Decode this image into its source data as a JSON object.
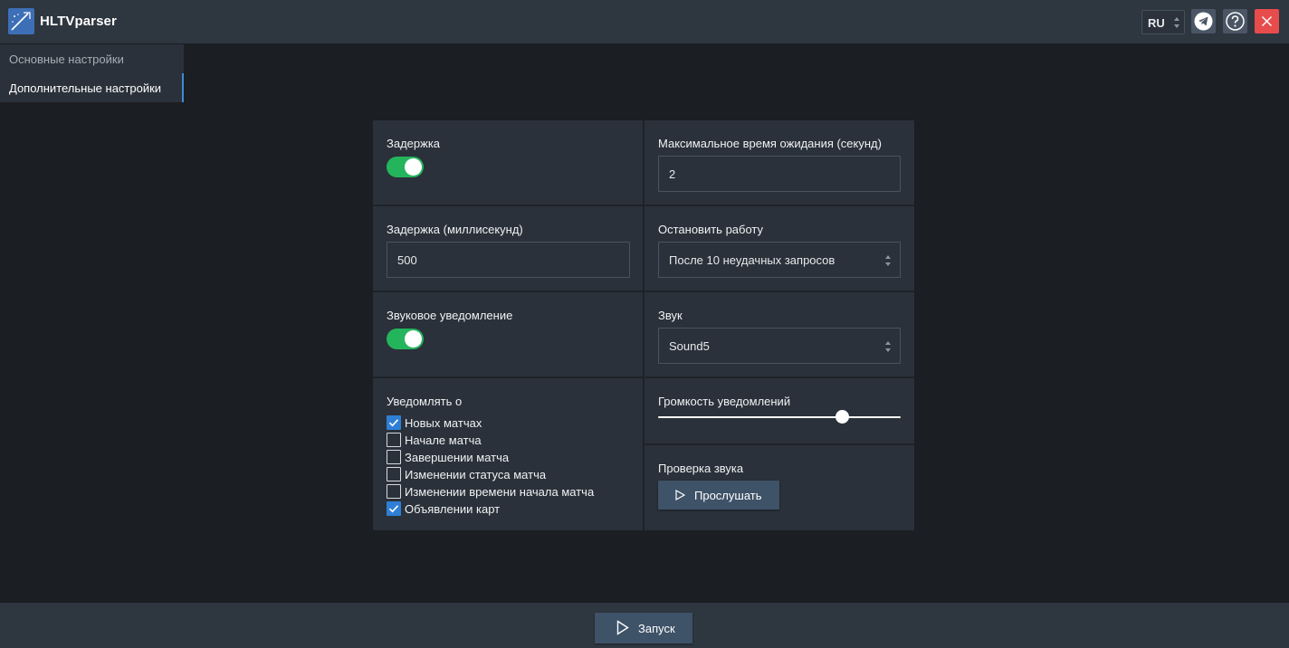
{
  "app": {
    "title": "HLTVparser",
    "language": "RU",
    "accent": "#3f8ad8",
    "close_color": "#e74c4c"
  },
  "toolbar": {
    "icons": [
      "telegram-icon",
      "help-icon",
      "close-icon"
    ]
  },
  "sidebar": {
    "items": [
      {
        "label": "Основные настройки",
        "active": false
      },
      {
        "label": "Дополнительные настройки",
        "active": true
      }
    ]
  },
  "settings": {
    "delay": {
      "label": "Задержка",
      "enabled": true
    },
    "max_wait": {
      "label": "Максимальное время ожидания (секунд)",
      "value": "2"
    },
    "delay_ms": {
      "label": "Задержка (миллисекунд)",
      "value": "500"
    },
    "stop_work": {
      "label": "Остановить работу",
      "value": "После 10 неудачных запросов"
    },
    "sound_notify": {
      "label": "Звуковое уведомление",
      "enabled": true
    },
    "sound": {
      "label": "Звук",
      "value": "Sound5"
    },
    "notify_about": {
      "label": "Уведомлять о",
      "options": [
        {
          "label": "Новых матчах",
          "checked": true
        },
        {
          "label": "Начале матча",
          "checked": false
        },
        {
          "label": "Завершении матча",
          "checked": false
        },
        {
          "label": "Изменении статуса матча",
          "checked": false
        },
        {
          "label": "Изменении времени начала матча",
          "checked": false
        },
        {
          "label": "Объявлении карт",
          "checked": true
        }
      ]
    },
    "volume": {
      "label": "Громкость уведомлений",
      "value": 0.76
    },
    "sound_test": {
      "label": "Проверка звука",
      "button": "Прослушать"
    }
  },
  "footer": {
    "run_button": "Запуск"
  },
  "colors": {
    "toggle_on": "#24b55c",
    "checkbox_on": "#2f7fd6",
    "button": "#3e5268"
  }
}
